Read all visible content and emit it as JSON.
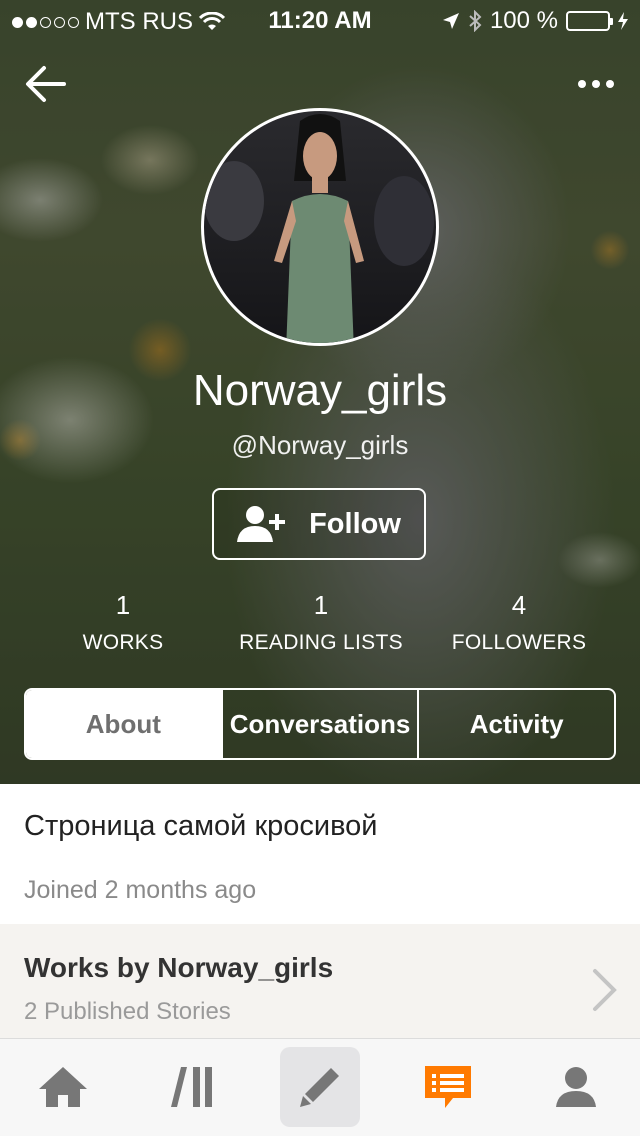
{
  "status": {
    "carrier": "MTS RUS",
    "time": "11:20 AM",
    "battery": "100 %",
    "battery_level": 1.0,
    "signal_dots_filled": 2,
    "signal_dots_total": 5
  },
  "profile": {
    "name": "Norway_girls",
    "handle": "@Norway_girls",
    "follow_label": "Follow"
  },
  "stats": [
    {
      "value": "1",
      "label": "WORKS"
    },
    {
      "value": "1",
      "label": "READING LISTS"
    },
    {
      "value": "4",
      "label": "FOLLOWERS"
    }
  ],
  "tabs": [
    {
      "label": "About",
      "active": true
    },
    {
      "label": "Conversations",
      "active": false
    },
    {
      "label": "Activity",
      "active": false
    }
  ],
  "about": {
    "bio": "Строница самой кросивой",
    "joined": "Joined 2 months ago"
  },
  "works": {
    "title": "Works by Norway_girls",
    "subtitle": "2 Published Stories"
  },
  "tabbar": {
    "items": [
      "home-icon",
      "library-icon",
      "write-icon",
      "messages-icon",
      "profile-icon"
    ],
    "active_color": "#ff7a00",
    "icon_color": "#777777"
  }
}
